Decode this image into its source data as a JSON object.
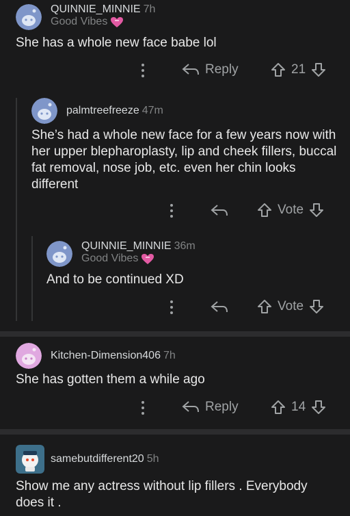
{
  "comments": [
    {
      "username": "QUINNIE_MINNIE",
      "time": "7h",
      "flair": "Good Vibes",
      "text": "She has a whole new face babe lol",
      "reply_label": "Reply",
      "score": "21"
    },
    {
      "username": "palmtreefreeze",
      "time": "47m",
      "text": "She’s had a whole new face for a few years now with her upper blepharoplasty, lip and cheek fillers, buccal fat removal, nose job, etc. even her chin looks different",
      "vote_label": "Vote"
    },
    {
      "username": "QUINNIE_MINNIE",
      "time": "36m",
      "flair": "Good Vibes",
      "text": "And to be continued XD",
      "vote_label": "Vote"
    },
    {
      "username": "Kitchen-Dimension406",
      "time": "7h",
      "text": "She has gotten them a while ago",
      "reply_label": "Reply",
      "score": "14"
    },
    {
      "username": "samebutdifferent20",
      "time": "5h",
      "text": "Show me any actress without lip fillers . Everybody does it ."
    }
  ],
  "colors": {
    "background": "#1a1a1b",
    "meta_text": "#818384",
    "action_text": "#a0a3a5",
    "avatar_blue": "#7f96c9",
    "avatar_pink": "#e0a8e0",
    "heart_pink": "#e25aa3"
  },
  "icons": {
    "more": "more-vertical-icon",
    "reply": "reply-arrow-icon",
    "upvote": "upvote-arrow-icon",
    "downvote": "downvote-arrow-icon",
    "flair": "pink-heart-icon"
  }
}
